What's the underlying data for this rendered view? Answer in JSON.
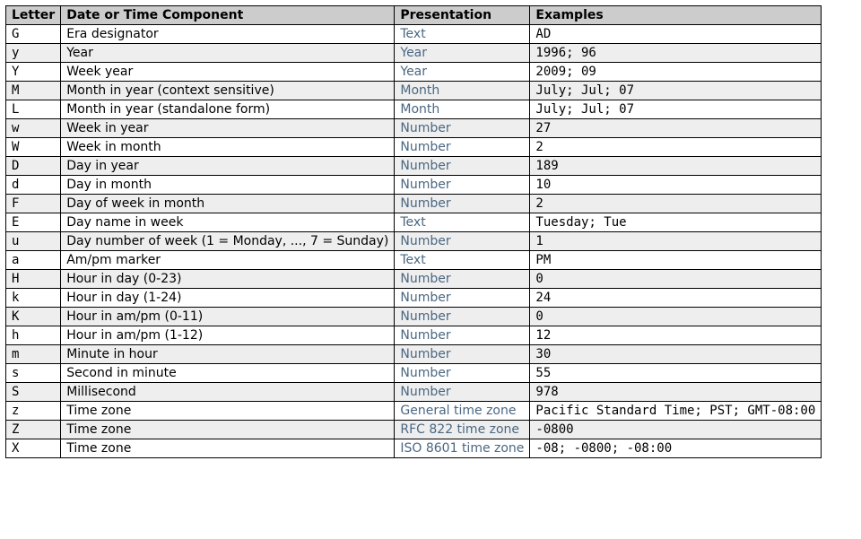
{
  "table": {
    "headers": {
      "letter": "Letter",
      "component": "Date or Time Component",
      "presentation": "Presentation",
      "examples": "Examples"
    },
    "rows": [
      {
        "letter": "G",
        "component": "Era designator",
        "presentation": "Text",
        "examples": "AD"
      },
      {
        "letter": "y",
        "component": "Year",
        "presentation": "Year",
        "examples": "1996; 96"
      },
      {
        "letter": "Y",
        "component": "Week year",
        "presentation": "Year",
        "examples": "2009; 09"
      },
      {
        "letter": "M",
        "component": "Month in year (context sensitive)",
        "presentation": "Month",
        "examples": "July; Jul; 07"
      },
      {
        "letter": "L",
        "component": "Month in year (standalone form)",
        "presentation": "Month",
        "examples": "July; Jul; 07"
      },
      {
        "letter": "w",
        "component": "Week in year",
        "presentation": "Number",
        "examples": "27"
      },
      {
        "letter": "W",
        "component": "Week in month",
        "presentation": "Number",
        "examples": "2"
      },
      {
        "letter": "D",
        "component": "Day in year",
        "presentation": "Number",
        "examples": "189"
      },
      {
        "letter": "d",
        "component": "Day in month",
        "presentation": "Number",
        "examples": "10"
      },
      {
        "letter": "F",
        "component": "Day of week in month",
        "presentation": "Number",
        "examples": "2"
      },
      {
        "letter": "E",
        "component": "Day name in week",
        "presentation": "Text",
        "examples": "Tuesday; Tue"
      },
      {
        "letter": "u",
        "component": "Day number of week (1 = Monday, ..., 7 = Sunday)",
        "presentation": "Number",
        "examples": "1"
      },
      {
        "letter": "a",
        "component": "Am/pm marker",
        "presentation": "Text",
        "examples": "PM"
      },
      {
        "letter": "H",
        "component": "Hour in day (0-23)",
        "presentation": "Number",
        "examples": "0"
      },
      {
        "letter": "k",
        "component": "Hour in day (1-24)",
        "presentation": "Number",
        "examples": "24"
      },
      {
        "letter": "K",
        "component": "Hour in am/pm (0-11)",
        "presentation": "Number",
        "examples": "0"
      },
      {
        "letter": "h",
        "component": "Hour in am/pm (1-12)",
        "presentation": "Number",
        "examples": "12"
      },
      {
        "letter": "m",
        "component": "Minute in hour",
        "presentation": "Number",
        "examples": "30"
      },
      {
        "letter": "s",
        "component": "Second in minute",
        "presentation": "Number",
        "examples": "55"
      },
      {
        "letter": "S",
        "component": "Millisecond",
        "presentation": "Number",
        "examples": "978"
      },
      {
        "letter": "z",
        "component": "Time zone",
        "presentation": "General time zone",
        "examples": "Pacific Standard Time; PST; GMT-08:00"
      },
      {
        "letter": "Z",
        "component": "Time zone",
        "presentation": "RFC 822 time zone",
        "examples": "-0800"
      },
      {
        "letter": "X",
        "component": "Time zone",
        "presentation": "ISO 8601 time zone",
        "examples": "-08; -0800; -08:00"
      }
    ]
  }
}
